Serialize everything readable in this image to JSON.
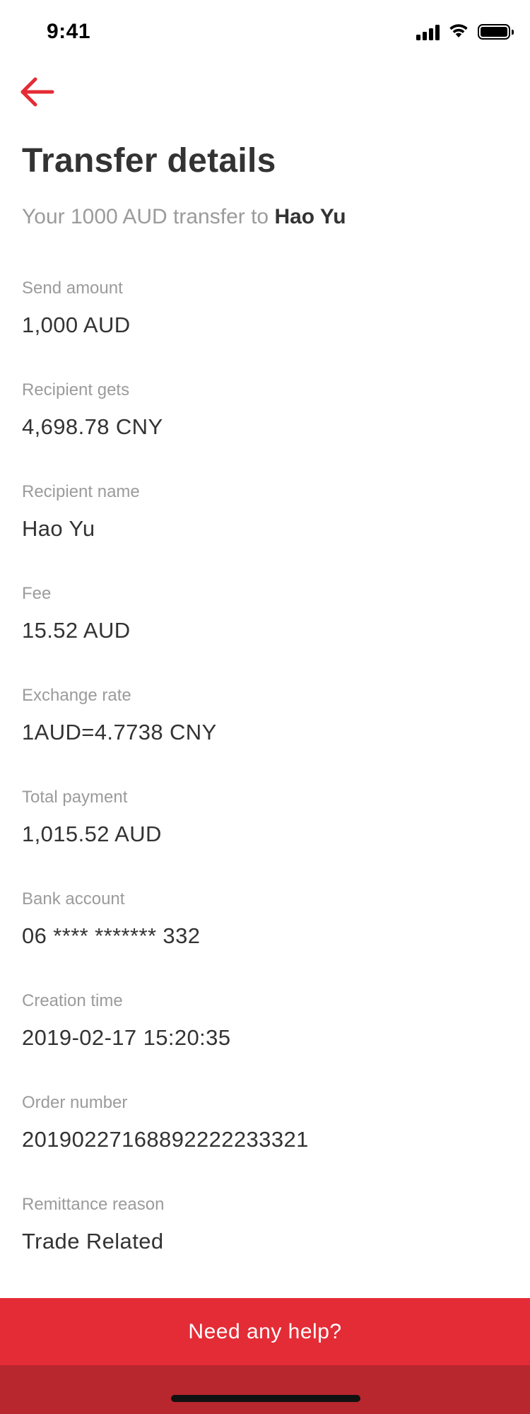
{
  "status_bar": {
    "time": "9:41",
    "icons": [
      "signal-icon",
      "wifi-icon",
      "battery-icon"
    ]
  },
  "header": {
    "back_icon": "arrow-left-icon",
    "title": "Transfer details",
    "subtitle_prefix": "Your 1000 AUD transfer to ",
    "subtitle_name": "Hao Yu"
  },
  "details": [
    {
      "label": "Send amount",
      "value": "1,000 AUD"
    },
    {
      "label": "Recipient gets",
      "value": "4,698.78 CNY"
    },
    {
      "label": "Recipient name",
      "value": "Hao Yu"
    },
    {
      "label": "Fee",
      "value": "15.52 AUD"
    },
    {
      "label": "Exchange rate",
      "value": "1AUD=4.7738 CNY"
    },
    {
      "label": "Total payment",
      "value": "1,015.52 AUD"
    },
    {
      "label": "Bank account",
      "value": "06 **** ******* 332"
    },
    {
      "label": "Creation time",
      "value": "2019-02-17 15:20:35"
    },
    {
      "label": "Order number",
      "value": "20190227168892222233321"
    },
    {
      "label": "Remittance reason",
      "value": "Trade Related"
    }
  ],
  "footer": {
    "help_label": "Need any help?"
  },
  "colors": {
    "accent": "#e42c36",
    "accent_dark": "#b8262e",
    "text_primary": "#333333",
    "text_secondary": "#9b9b9b",
    "background": "#ffffff"
  }
}
